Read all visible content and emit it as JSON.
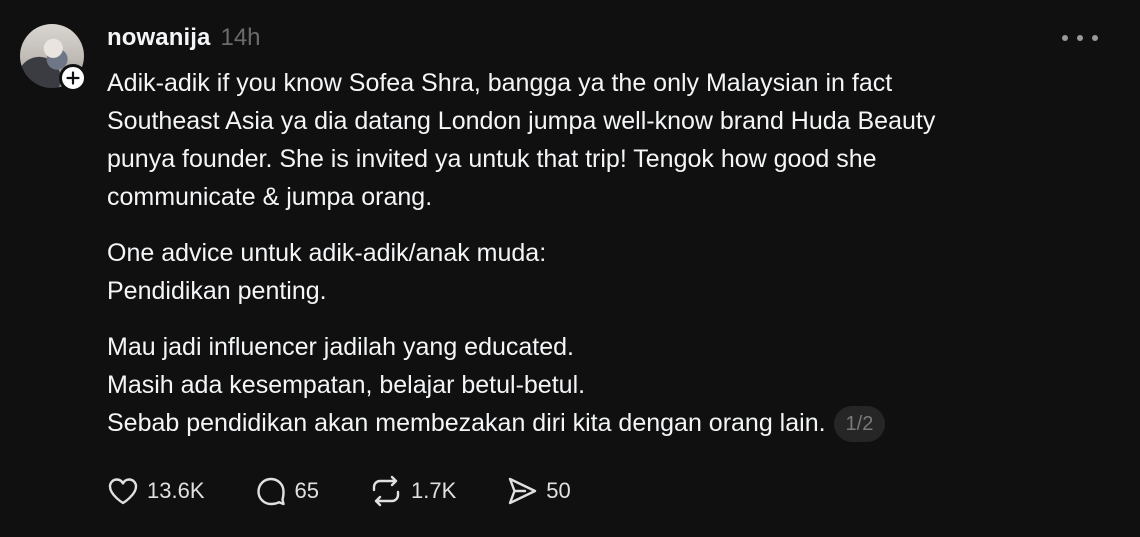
{
  "post": {
    "username": "nowanija",
    "time": "14h",
    "paragraphs": [
      [
        "Adik-adik if you know Sofea Shra, bangga ya the only Malaysian in fact",
        "Southeast Asia ya dia datang London jumpa well-know brand Huda Beauty",
        "punya founder. She is invited ya untuk that trip! Tengok how good she",
        "communicate & jumpa orang."
      ],
      [
        "One advice untuk adik-adik/anak muda:",
        "Pendidikan penting."
      ],
      [
        "Mau jadi influencer jadilah yang educated.",
        "Masih ada kesempatan, belajar betul-betul.",
        "Sebab pendidikan akan membezakan diri kita dengan orang lain."
      ]
    ],
    "pager": "1/2"
  },
  "actions": {
    "likes": "13.6K",
    "comments": "65",
    "reposts": "1.7K",
    "shares": "50"
  },
  "icons": {
    "like": "heart-icon",
    "comment": "comment-bubble-icon",
    "repost": "repost-icon",
    "share": "send-icon",
    "more": "more-horizontal-icon",
    "follow": "plus-icon"
  },
  "colors": {
    "background": "#101010",
    "text": "#f3f5f7",
    "muted": "#6b6b6b"
  }
}
